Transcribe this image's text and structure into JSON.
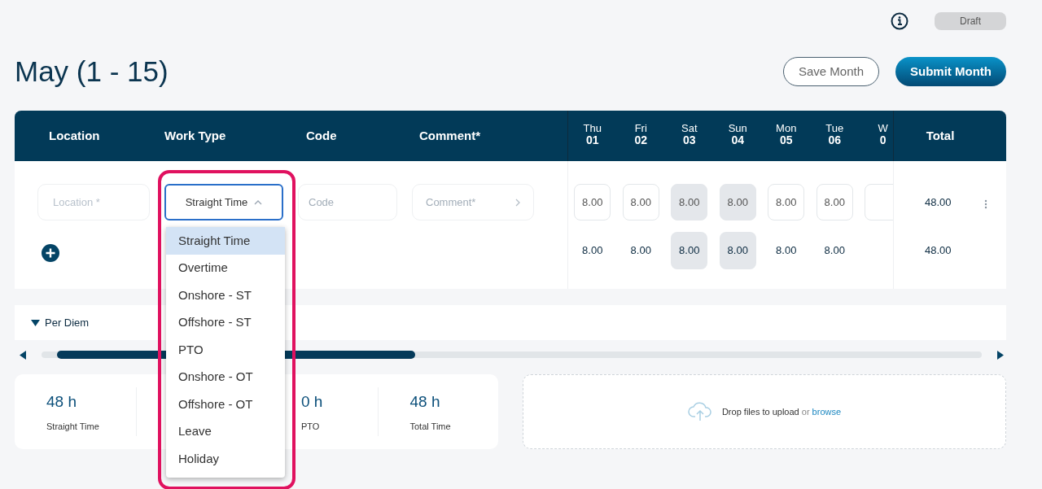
{
  "status": "Draft",
  "title": "May (1 - 15)",
  "buttons": [
    {
      "label": "Save Month",
      "kind": "secondary"
    },
    {
      "label": "Submit Month",
      "kind": "primary"
    }
  ],
  "table": {
    "columns": [
      "Location",
      "Work Type",
      "Code",
      "Comment*"
    ],
    "days": [
      {
        "day": "Thu",
        "date": "01",
        "weekend": false
      },
      {
        "day": "Fri",
        "date": "02",
        "weekend": false
      },
      {
        "day": "Sat",
        "date": "03",
        "weekend": true
      },
      {
        "day": "Sun",
        "date": "04",
        "weekend": true
      },
      {
        "day": "Mon",
        "date": "05",
        "weekend": false
      },
      {
        "day": "Tue",
        "date": "06",
        "weekend": false
      },
      {
        "day": "W",
        "date": "0",
        "weekend": false
      }
    ],
    "total_label": "Total",
    "row": {
      "location_placeholder": "Location *",
      "work_type": "Straight Time",
      "code_placeholder": "Code",
      "comment_placeholder": "Comment*",
      "hours": [
        "8.00",
        "8.00",
        "8.00",
        "8.00",
        "8.00",
        "8.00"
      ],
      "total": "48.00"
    },
    "totals": {
      "hours": [
        "8.00",
        "8.00",
        "8.00",
        "8.00",
        "8.00",
        "8.00"
      ],
      "total": "48.00"
    }
  },
  "dropdown": {
    "expanded": true,
    "options": [
      {
        "label": "Straight Time",
        "selected": true
      },
      {
        "label": "Overtime",
        "selected": false
      },
      {
        "label": "Onshore - ST",
        "selected": false
      },
      {
        "label": "Offshore - ST",
        "selected": false
      },
      {
        "label": "PTO",
        "selected": false
      },
      {
        "label": "Onshore - OT",
        "selected": false
      },
      {
        "label": "Offshore - OT",
        "selected": false
      },
      {
        "label": "Leave",
        "selected": false
      },
      {
        "label": "Holiday",
        "selected": false
      }
    ]
  },
  "per_diem": {
    "label": "Per Diem",
    "expanded": true
  },
  "summary": [
    {
      "value": "48 h",
      "label": "Straight Time"
    },
    {
      "value": "0 h",
      "label": "PTO"
    },
    {
      "value": "48 h",
      "label": "Total Time"
    }
  ],
  "upload": {
    "text": "Drop files to upload",
    "link_prefix": "or",
    "link": "browse"
  }
}
